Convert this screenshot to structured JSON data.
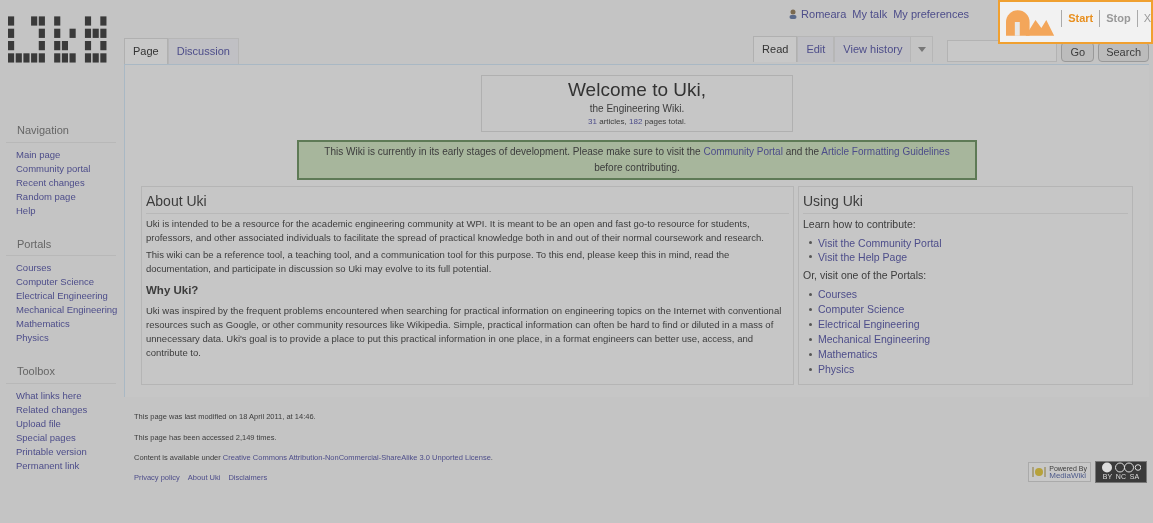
{
  "user_links": [
    {
      "label": "Romeara",
      "kind": "user"
    },
    {
      "label": "My talk",
      "kind": "link"
    },
    {
      "label": "My preferences",
      "kind": "link"
    }
  ],
  "recorder": {
    "start": "Start",
    "stop": "Stop",
    "close": "X"
  },
  "page_tabs": [
    {
      "label": "Page",
      "selected": true
    },
    {
      "label": "Discussion",
      "selected": false
    }
  ],
  "view_tabs": [
    {
      "label": "Read",
      "selected": true
    },
    {
      "label": "Edit",
      "selected": false
    },
    {
      "label": "View history",
      "selected": false
    }
  ],
  "search": {
    "go": "Go",
    "search": "Search"
  },
  "sidebar": [
    {
      "title": "Navigation",
      "items": [
        "Main page",
        "Community portal",
        "Recent changes",
        "Random page",
        "Help"
      ]
    },
    {
      "title": "Portals",
      "items": [
        "Courses",
        "Computer Science",
        "Electrical Engineering",
        "Mechanical Engineering",
        "Mathematics",
        "Physics"
      ]
    },
    {
      "title": "Toolbox",
      "items": [
        "What links here",
        "Related changes",
        "Upload file",
        "Special pages",
        "Printable version",
        "Permanent link"
      ]
    }
  ],
  "welcome": {
    "title": "Welcome to Uki,",
    "subtitle": "the Engineering Wiki.",
    "stats": [
      {
        "text": "31",
        "kind": "link"
      },
      {
        "text": " articles, ",
        "kind": "plain"
      },
      {
        "text": "182",
        "kind": "link"
      },
      {
        "text": " pages total.",
        "kind": "plain"
      }
    ]
  },
  "notice": [
    {
      "text": "This Wiki is currently in its early stages of development. Please make sure to visit the ",
      "kind": "plain"
    },
    {
      "text": "Community Portal",
      "kind": "link"
    },
    {
      "text": " and the ",
      "kind": "plain"
    },
    {
      "text": "Article Formatting Guidelines",
      "kind": "link"
    },
    {
      "text": " before contributing.",
      "kind": "plain"
    }
  ],
  "about": {
    "title": "About Uki",
    "paragraphs": [
      "Uki is intended to be a resource for the academic engineering community at WPI. It is meant to be an open and fast go-to resource for students, professors, and other associated individuals to facilitate the spread of practical knowledge both in and out of their normal coursework and research.",
      "This wiki can be a reference tool, a teaching tool, and a communication tool for this purpose. To this end, please keep this in mind, read the documentation, and participate in discussion so Uki may evolve to its full potential."
    ],
    "subtitle": "Why Uki?",
    "why": [
      "Uki was inspired by the frequent problems encountered when searching for practical information on engineering topics on the Internet with conventional resources such as Google, or other community resources like Wikipedia. Simple, practical information can often be hard to find or diluted in a mass of unnecessary data. Uki's goal is to provide a place to put this practical information in one place, in a format engineers can better use, access, and contribute to."
    ]
  },
  "using": {
    "title": "Using Uki",
    "intro": "Learn how to contribute:",
    "links": [
      "Visit the Community Portal",
      "Visit the Help Page"
    ],
    "intro2": "Or, visit one of the Portals:",
    "portals": [
      "Courses",
      "Computer Science",
      "Electrical Engineering",
      "Mechanical Engineering",
      "Mathematics",
      "Physics"
    ]
  },
  "footer": {
    "lines": [
      [
        {
          "text": "This page was last modified on 18 April 2011, at 14:46.",
          "kind": "plain"
        }
      ],
      [
        {
          "text": "This page has been accessed 2,149 times.",
          "kind": "plain"
        }
      ],
      [
        {
          "text": "Content is available under ",
          "kind": "plain"
        },
        {
          "text": "Creative Commons Attribution-NonCommercial-ShareAlike 3.0 Unported License",
          "kind": "link"
        },
        {
          "text": ".",
          "kind": "plain"
        }
      ]
    ],
    "links": [
      "Privacy policy",
      "About Uki",
      "Disclaimers"
    ],
    "powered": [
      "Powered By",
      "MediaWiki"
    ],
    "license": "BY  NC  SA"
  }
}
